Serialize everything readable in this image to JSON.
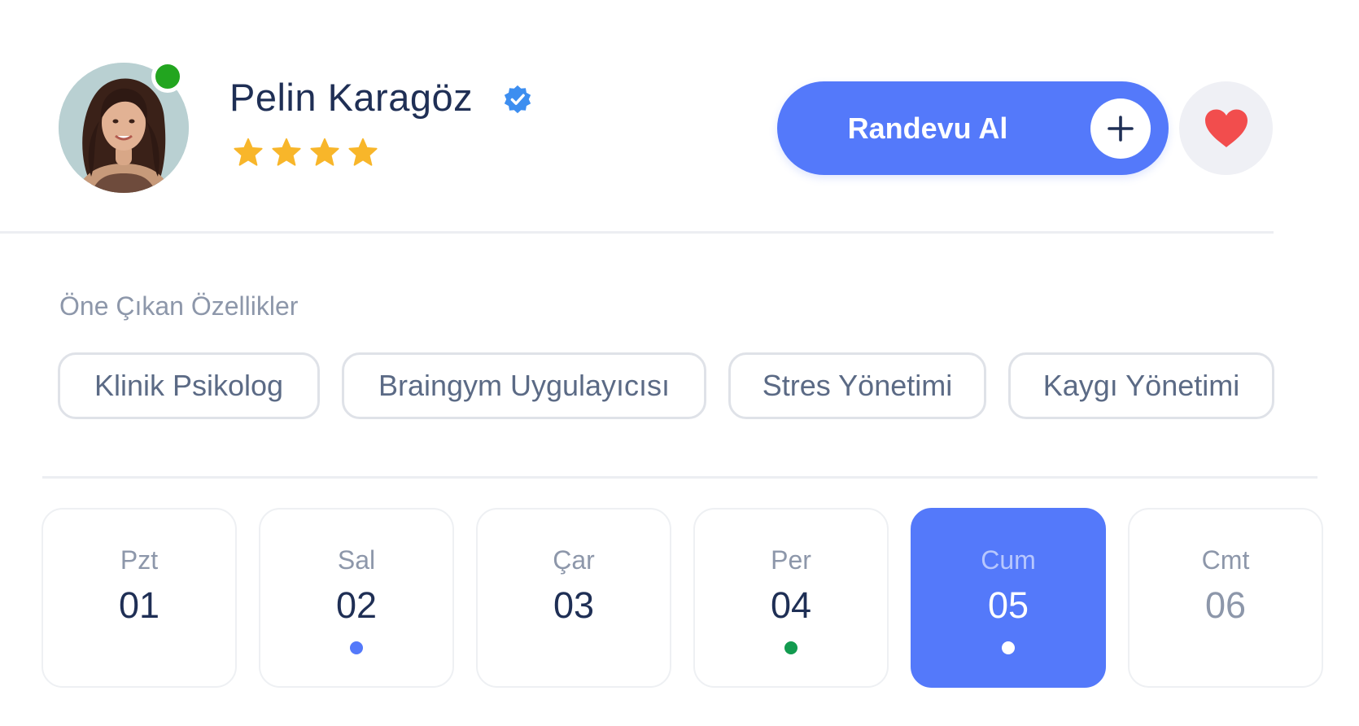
{
  "profile": {
    "name": "Pelin Karagöz",
    "rating": 4,
    "online": true,
    "online_color": "#22a51f",
    "verified": true,
    "verified_icon": "verified-badge-icon"
  },
  "actions": {
    "appointment_label": "Randevu Al",
    "appointment_icon": "plus-icon",
    "favorite_icon": "heart-icon",
    "accent_color": "#5479fa",
    "favorite_color": "#f24d4d"
  },
  "features": {
    "title": "Öne Çıkan Özellikler",
    "tags": [
      "Klinik Psikolog",
      "Braingym Uygulayıcısı",
      "Stres Yönetimi",
      "Kaygı Yönetimi"
    ]
  },
  "days": [
    {
      "name": "Pzt",
      "num": "01",
      "dot": null,
      "state": "normal"
    },
    {
      "name": "Sal",
      "num": "02",
      "dot": "#5479fa",
      "state": "normal"
    },
    {
      "name": "Çar",
      "num": "03",
      "dot": null,
      "state": "normal"
    },
    {
      "name": "Per",
      "num": "04",
      "dot": "#129b4f",
      "state": "normal"
    },
    {
      "name": "Cum",
      "num": "05",
      "dot": "#ffffff",
      "state": "selected"
    },
    {
      "name": "Cmt",
      "num": "06",
      "dot": null,
      "state": "muted"
    }
  ]
}
